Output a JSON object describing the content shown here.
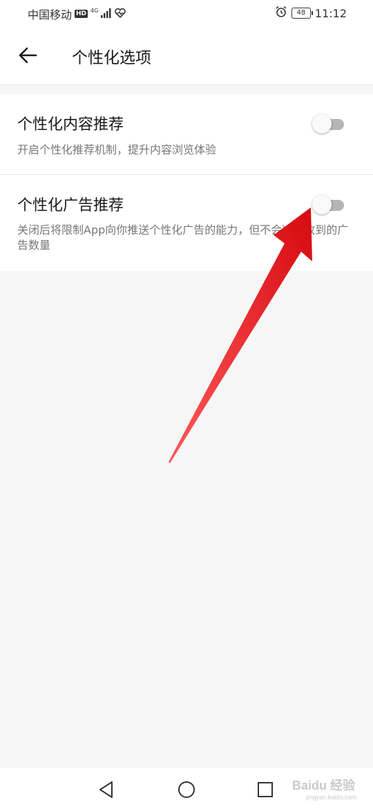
{
  "status_bar": {
    "carrier": "中国移动",
    "hd_label": "HD",
    "network_label": "4G",
    "battery_level": "48",
    "time": "11:12",
    "icons": [
      "signal-icon",
      "heart-rate-icon",
      "alarm-icon",
      "battery-icon"
    ]
  },
  "app_bar": {
    "title": "个性化选项",
    "back_icon": "back-arrow-icon"
  },
  "settings": [
    {
      "title": "个性化内容推荐",
      "description": "开启个性化推荐机制，提升内容浏览体验",
      "enabled": false
    },
    {
      "title": "个性化广告推荐",
      "description": "关闭后将限制App向你推送个性化广告的能力，但不会减少收到的广告数量",
      "enabled": false
    }
  ],
  "annotation": {
    "arrow_color": "#e8141a"
  },
  "nav_bar": {
    "icons": [
      "nav-back-icon",
      "nav-home-icon",
      "nav-recent-icon"
    ]
  },
  "watermark": {
    "text": "Baidu 经验",
    "sub": "jingyan.baidu.com"
  },
  "colors": {
    "background": "#f6f6f6",
    "card": "#ffffff",
    "toggle_off_track": "#b5b5b5"
  }
}
